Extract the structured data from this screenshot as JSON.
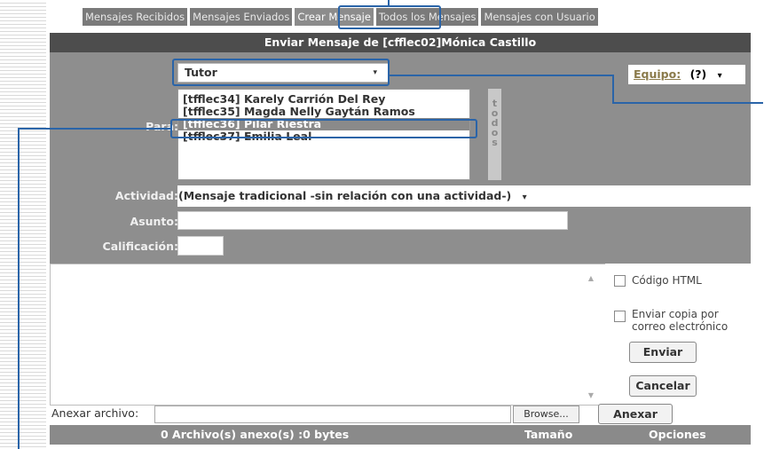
{
  "tabs": [
    {
      "label": "Mensajes Recibidos",
      "active": false
    },
    {
      "label": "Mensajes Enviados",
      "active": false
    },
    {
      "label": "Crear Mensaje",
      "active": true
    },
    {
      "label": "Todos los Mensajes",
      "active": false
    },
    {
      "label": "Mensajes con Usuario",
      "active": false
    }
  ],
  "title": "Enviar Mensaje de [cfflec02]Mónica Castillo",
  "para_label": "Para:",
  "role_select": {
    "value": "Tutor",
    "arrow": "▾"
  },
  "equipo": {
    "label": "Equipo:",
    "value": "(?)",
    "arrow": "▾"
  },
  "recipients": [
    "[tfflec34] Karely Carrión Del Rey",
    "[tfflec35] Magda Nelly Gaytán Ramos",
    "[tfflec36] Pilar Riestra",
    "[tfflec37] Emilia Leal"
  ],
  "selected_recipient_index": 2,
  "todos_button": "todos",
  "actividad": {
    "label": "Actividad:",
    "value": "(Mensaje tradicional -sin relación con una actividad-)",
    "arrow": "▾"
  },
  "asunto_label": "Asunto:",
  "calificacion_label": "Calificación:",
  "options": {
    "codigo_html": "Código HTML",
    "enviar_copia_1": "Enviar copia por",
    "enviar_copia_2": "correo electrónico"
  },
  "buttons": {
    "enviar": "Enviar",
    "cancelar": "Cancelar",
    "browse": "Browse...",
    "anexar": "Anexar"
  },
  "anexar_archivo_label": "Anexar archivo:",
  "attachments_bar": {
    "count_text": "0 Archivo(s) anexo(s) :0 bytes",
    "size_col": "Tamaño",
    "options_col": "Opciones"
  },
  "colors": {
    "highlight": "#2a64a8",
    "title_bar": "#4d4d4d",
    "form_bg": "#8e8e8e"
  }
}
